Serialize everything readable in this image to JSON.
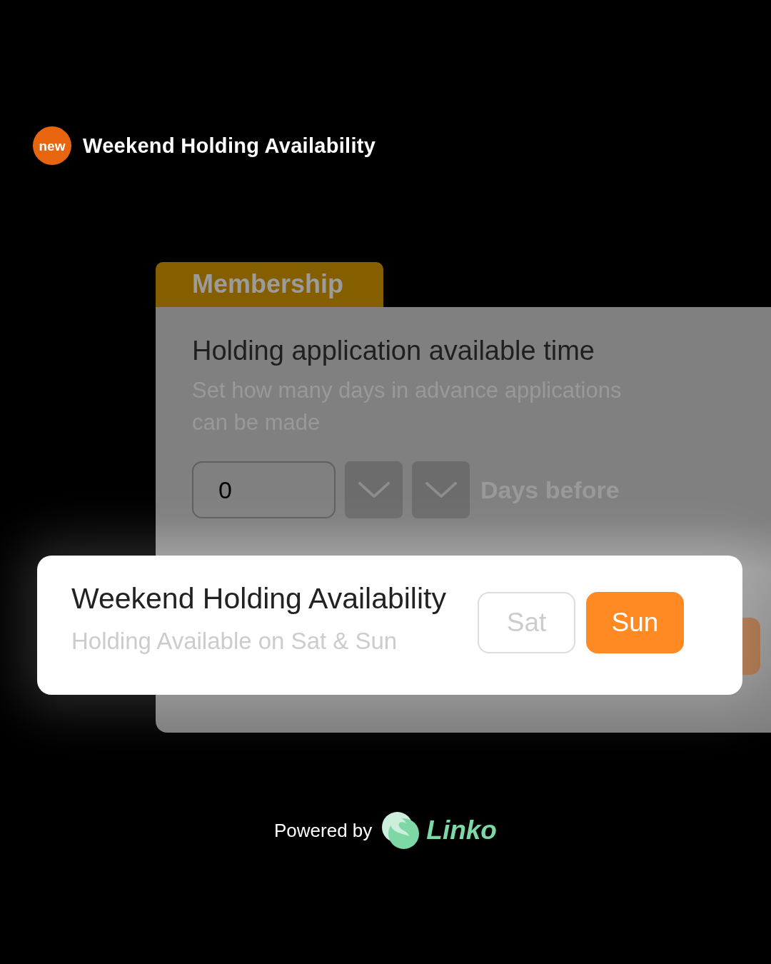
{
  "badge": {
    "label": "new"
  },
  "headline": "Weekend Holding Availability",
  "settings_panel": {
    "dimmed": true,
    "tab": "Membership",
    "title": "Holding application available time",
    "description": "Set how many days in advance applications can be made",
    "days_field": {
      "value": "0"
    },
    "unit_label": "Days before"
  },
  "weekend_card": {
    "title": "Weekend Holding Availability",
    "subtitle": "Holding Available on Sat & Sun",
    "days": [
      {
        "label": "Sat",
        "selected": false
      },
      {
        "label": "Sun",
        "selected": true
      }
    ]
  },
  "footer": {
    "powered_by": "Powered by",
    "brand": "Linko"
  }
}
